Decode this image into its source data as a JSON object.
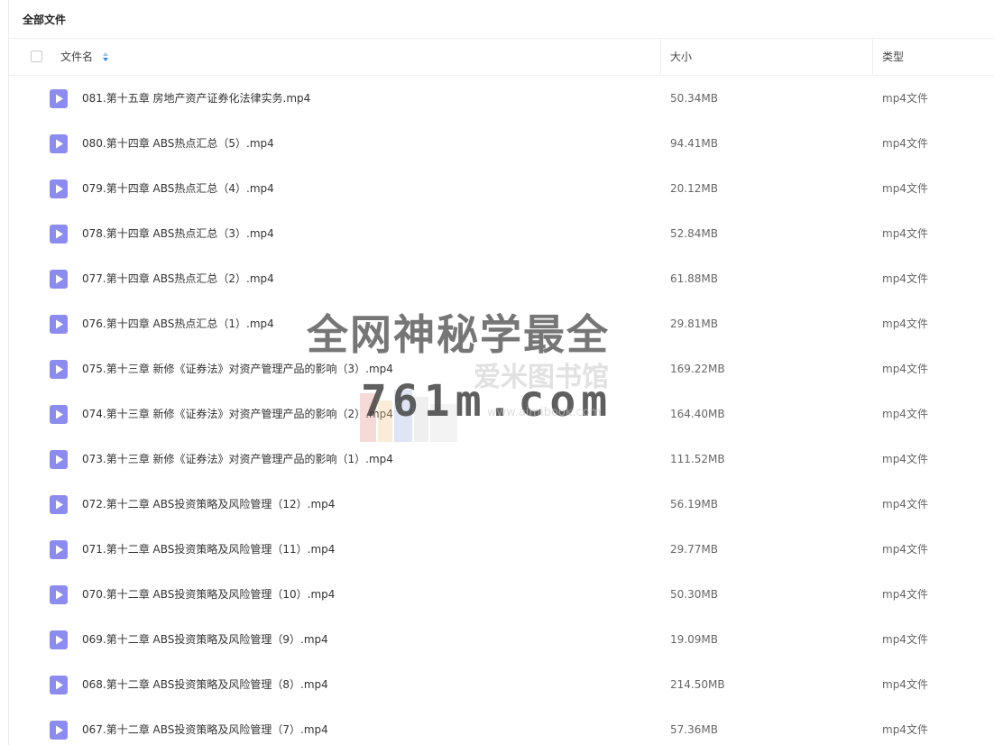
{
  "breadcrumb": {
    "title": "全部文件"
  },
  "table": {
    "headers": {
      "name": "文件名",
      "size": "大小",
      "type": "类型"
    },
    "rows": [
      {
        "name": "081.第十五章 房地产资产证券化法律实务.mp4",
        "size": "50.34MB",
        "type": "mp4文件"
      },
      {
        "name": "080.第十四章 ABS热点汇总（5）.mp4",
        "size": "94.41MB",
        "type": "mp4文件"
      },
      {
        "name": "079.第十四章 ABS热点汇总（4）.mp4",
        "size": "20.12MB",
        "type": "mp4文件"
      },
      {
        "name": "078.第十四章 ABS热点汇总（3）.mp4",
        "size": "52.84MB",
        "type": "mp4文件"
      },
      {
        "name": "077.第十四章 ABS热点汇总（2）.mp4",
        "size": "61.88MB",
        "type": "mp4文件"
      },
      {
        "name": "076.第十四章 ABS热点汇总（1）.mp4",
        "size": "29.81MB",
        "type": "mp4文件"
      },
      {
        "name": "075.第十三章 新修《证券法》对资产管理产品的影响（3）.mp4",
        "size": "169.22MB",
        "type": "mp4文件"
      },
      {
        "name": "074.第十三章 新修《证券法》对资产管理产品的影响（2）.mp4",
        "size": "164.40MB",
        "type": "mp4文件"
      },
      {
        "name": "073.第十三章 新修《证券法》对资产管理产品的影响（1）.mp4",
        "size": "111.52MB",
        "type": "mp4文件"
      },
      {
        "name": "072.第十二章 ABS投资策略及风险管理（12）.mp4",
        "size": "56.19MB",
        "type": "mp4文件"
      },
      {
        "name": "071.第十二章 ABS投资策略及风险管理（11）.mp4",
        "size": "29.77MB",
        "type": "mp4文件"
      },
      {
        "name": "070.第十二章 ABS投资策略及风险管理（10）.mp4",
        "size": "50.30MB",
        "type": "mp4文件"
      },
      {
        "name": "069.第十二章 ABS投资策略及风险管理（9）.mp4",
        "size": "19.09MB",
        "type": "mp4文件"
      },
      {
        "name": "068.第十二章 ABS投资策略及风险管理（8）.mp4",
        "size": "214.50MB",
        "type": "mp4文件"
      },
      {
        "name": "067.第十二章 ABS投资策略及风险管理（7）.mp4",
        "size": "57.36MB",
        "type": "mp4文件"
      }
    ]
  },
  "icons": {
    "file_icon": "video-file-icon",
    "sort_icon": "sort-icon",
    "checkbox": "checkbox"
  },
  "colors": {
    "file_icon": "#8c8cf0",
    "sort_up": "#9ec5f5",
    "sort_down": "#2d8cf0"
  },
  "watermark": {
    "main": "全网神秘学最全",
    "sub": "爱米图书馆",
    "url": "761m.com",
    "sub_url": "www.aimibook.com"
  }
}
